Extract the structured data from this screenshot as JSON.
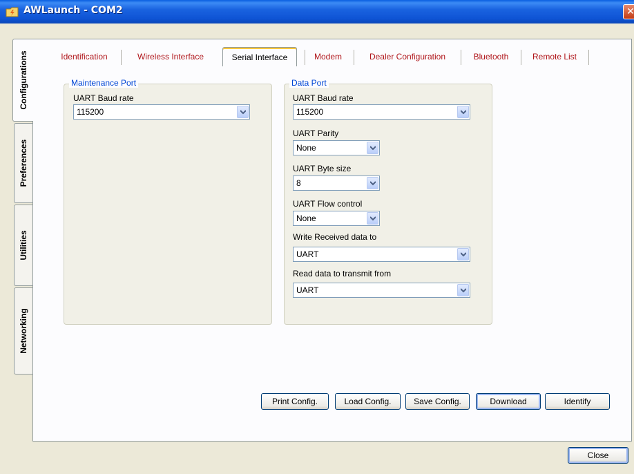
{
  "window": {
    "title": "AWLaunch - COM2",
    "close_glyph": "✕"
  },
  "side_tabs": [
    "Configurations",
    "Preferences",
    "Utilities",
    "Networking"
  ],
  "top_tabs": [
    "Identification",
    "Wireless Interface",
    "Serial Interface",
    "Modem",
    "Dealer Configuration",
    "Bluetooth",
    "Remote List"
  ],
  "active_top_tab": "Serial Interface",
  "active_side_tab": "Configurations",
  "maintenance_port": {
    "legend": "Maintenance Port",
    "baud_label": "UART Baud rate",
    "baud_value": "115200"
  },
  "data_port": {
    "legend": "Data Port",
    "baud_label": "UART Baud rate",
    "baud_value": "115200",
    "parity_label": "UART Parity",
    "parity_value": "None",
    "byte_size_label": "UART Byte size",
    "byte_size_value": "8",
    "flow_label": "UART Flow control",
    "flow_value": "None",
    "write_label": "Write Received data to",
    "write_value": "UART",
    "read_label": "Read data to transmit from",
    "read_value": "UART"
  },
  "buttons": {
    "print": "Print Config.",
    "load": "Load Config.",
    "save": "Save Config.",
    "download": "Download",
    "identify": "Identify",
    "close": "Close"
  },
  "colors": {
    "title_bar": "#0E53D4",
    "tab_text": "#B0161B",
    "group_legend": "#0046D5",
    "active_tab_highlight": "#FFC83C"
  },
  "icons": {
    "app": "folder-lightning-icon",
    "dropdown": "chevron-down-icon"
  }
}
